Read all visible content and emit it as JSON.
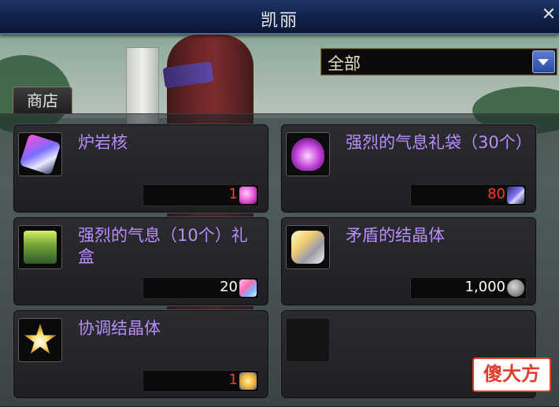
{
  "window": {
    "title": "凯丽",
    "close_icon": "close-icon"
  },
  "filter": {
    "selected": "全部",
    "icon": "dropdown-arrow-icon"
  },
  "tabs": [
    {
      "label": "商店"
    }
  ],
  "items": [
    {
      "name": "炉岩核",
      "price": "1",
      "price_color": "#ff3b2b",
      "icon": "pink-crystal-icon",
      "currency_icon": "pink-orb-currency-icon"
    },
    {
      "name": "强烈的气息礼袋（30个）",
      "price": "80",
      "price_color": "#ff3b2b",
      "icon": "purple-gift-bag-icon",
      "currency_icon": "magic-wand-currency-icon"
    },
    {
      "name": "强烈的气息（10个）礼盒",
      "price": "20",
      "price_color": "#ffffff",
      "icon": "green-gift-box-icon",
      "currency_icon": "crystal-currency-icon"
    },
    {
      "name": "矛盾的结晶体",
      "price": "1,000",
      "price_color": "#ffffff",
      "icon": "gold-crystal-icon",
      "currency_icon": "gray-coin-currency-icon"
    },
    {
      "name": "协调结晶体",
      "price": "1",
      "price_color": "#ff3b2b",
      "icon": "star-crystal-icon",
      "currency_icon": "gold-crystal-currency-icon"
    },
    {
      "name": "",
      "price": "",
      "icon": "empty-slot"
    }
  ],
  "watermark": {
    "text": "傻大方"
  }
}
